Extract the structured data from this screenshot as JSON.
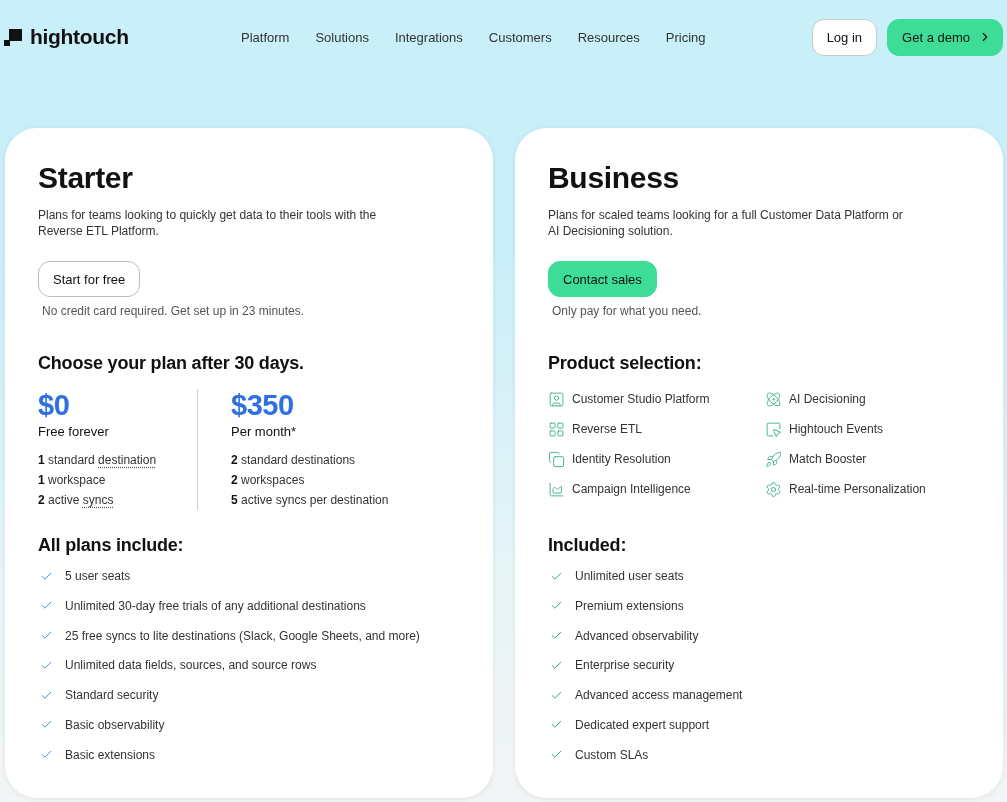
{
  "header": {
    "brand": "hightouch",
    "nav": [
      "Platform",
      "Solutions",
      "Integrations",
      "Customers",
      "Resources",
      "Pricing"
    ],
    "buttons": [
      {
        "label": "Log in",
        "kind": "outline"
      },
      {
        "label": "Get a demo",
        "kind": "primary"
      }
    ]
  },
  "plans": [
    {
      "kind": "starter",
      "title": "Starter",
      "description": "Plans for teams looking to quickly get data to their tools with the Reverse ETL Platform.",
      "button": "Start for free",
      "note": "No credit card required. Get set up in 23 minutes.",
      "section_heading": "Choose your plan after 30 days.",
      "tiers": [
        {
          "price": "$0",
          "period": "Free forever",
          "limits": [
            {
              "text": "**1** standard",
              "term": "destination"
            },
            {
              "text": "**1** workspace"
            },
            {
              "text": "**2** active",
              "term": "syncs"
            }
          ]
        },
        {
          "price": "$350",
          "period": "Per month*",
          "limits": [
            {
              "text": "**2** standard destinations"
            },
            {
              "text": "**2** workspaces"
            },
            {
              "text": "**5** active syncs per destination"
            }
          ]
        }
      ],
      "features_heading": "All plans include:",
      "features": [
        "5 user seats",
        "Unlimited 30-day free trials of any additional destinations",
        "25 free syncs to lite destinations (Slack, Google Sheets, and more)",
        "Unlimited data fields, sources, and source rows",
        "Standard security",
        "Basic observability",
        "Basic extensions"
      ]
    },
    {
      "kind": "business",
      "title": "Business",
      "description": "Plans for scaled teams looking for a full Customer Data Platform or AI Decisioning solution.",
      "button": "Contact sales",
      "note": "Only pay for what you need.",
      "section_heading": "Product selection:",
      "products": [
        "Customer Studio Platform",
        "AI Decisioning",
        "Reverse ETL",
        "Hightouch Events",
        "Identity Resolution",
        "Match Booster",
        "Campaign Intelligence",
        "Real-time Personalization"
      ],
      "features_heading": "Included:",
      "features": [
        "Unlimited user seats",
        "Premium extensions",
        "Advanced observability",
        "Enterprise security",
        "Advanced access management",
        "Dedicated expert support",
        "Custom SLAs"
      ]
    }
  ]
}
